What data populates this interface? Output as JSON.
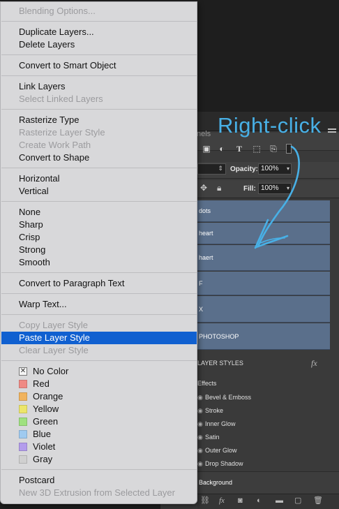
{
  "menu": {
    "items": [
      {
        "label": "Blending Options...",
        "enabled": false
      },
      {
        "label": "Duplicate Layers...",
        "enabled": true
      },
      {
        "label": "Delete Layers",
        "enabled": true
      },
      {
        "label": "Convert to Smart Object",
        "enabled": true
      },
      {
        "label": "Link Layers",
        "enabled": true
      },
      {
        "label": "Select Linked Layers",
        "enabled": false
      },
      {
        "label": "Rasterize Type",
        "enabled": true
      },
      {
        "label": "Rasterize Layer Style",
        "enabled": false
      },
      {
        "label": "Create Work Path",
        "enabled": false
      },
      {
        "label": "Convert to Shape",
        "enabled": true
      },
      {
        "label": "Horizontal",
        "enabled": true
      },
      {
        "label": "Vertical",
        "enabled": true
      },
      {
        "label": "None",
        "enabled": true
      },
      {
        "label": "Sharp",
        "enabled": true
      },
      {
        "label": "Crisp",
        "enabled": true
      },
      {
        "label": "Strong",
        "enabled": true
      },
      {
        "label": "Smooth",
        "enabled": true
      },
      {
        "label": "Convert to Paragraph Text",
        "enabled": true
      },
      {
        "label": "Warp Text...",
        "enabled": true
      },
      {
        "label": "Copy Layer Style",
        "enabled": false
      },
      {
        "label": "Paste Layer Style",
        "enabled": true,
        "selected": true
      },
      {
        "label": "Clear Layer Style",
        "enabled": false
      },
      {
        "label": "No Color",
        "enabled": true,
        "color": "none"
      },
      {
        "label": "Red",
        "enabled": true,
        "color": "#ef8a84"
      },
      {
        "label": "Orange",
        "enabled": true,
        "color": "#f1b35d"
      },
      {
        "label": "Yellow",
        "enabled": true,
        "color": "#ece56a"
      },
      {
        "label": "Green",
        "enabled": true,
        "color": "#9fe17f"
      },
      {
        "label": "Blue",
        "enabled": true,
        "color": "#9fcaf0"
      },
      {
        "label": "Violet",
        "enabled": true,
        "color": "#b39cec"
      },
      {
        "label": "Gray",
        "enabled": true,
        "color": "#d0d0d0"
      },
      {
        "label": "Postcard",
        "enabled": true
      },
      {
        "label": "New 3D Extrusion from Selected Layer",
        "enabled": false
      }
    ],
    "highlight_color": "#1060d0"
  },
  "annotation": {
    "text": "Right-click",
    "color": "#48b0e6"
  },
  "panel": {
    "tab_label": "nels",
    "opacity_label": "Opacity:",
    "opacity_value": "100%",
    "fill_label": "Fill:",
    "fill_value": "100%",
    "layers": [
      {
        "name": "dots"
      },
      {
        "name": "heart"
      },
      {
        "name": "haert"
      },
      {
        "name": "F"
      },
      {
        "name": "X"
      },
      {
        "name": "PHOTOSHOP"
      },
      {
        "name": "LAYER STYLES"
      }
    ],
    "fx_label": "fx",
    "effects_label": "Effects",
    "effects": [
      "Bevel & Emboss",
      "Stroke",
      "Inner Glow",
      "Satin",
      "Outer Glow",
      "Drop Shadow"
    ],
    "background_layer": "Background",
    "selected_layer_color": "#5a6f8b"
  }
}
